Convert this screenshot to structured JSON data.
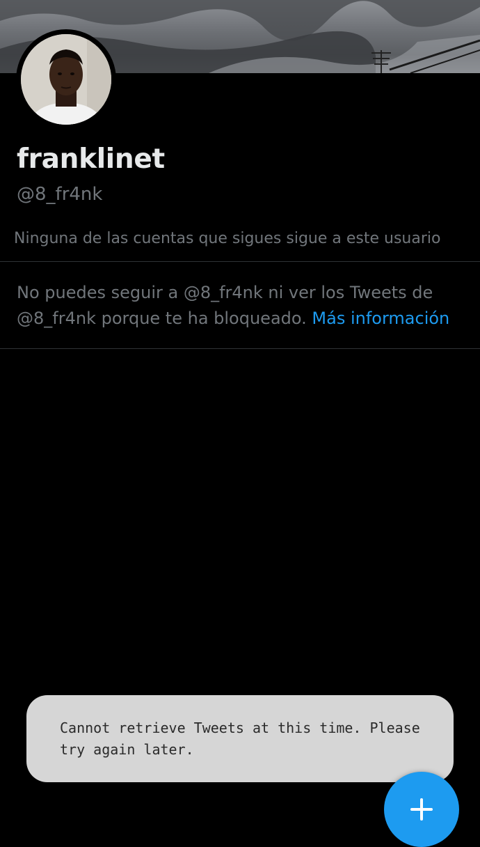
{
  "profile": {
    "display_name": "franklinet",
    "handle": "@8_fr4nk",
    "followers_you_know": "Ninguna de las cuentas que sigues sigue a este usuario"
  },
  "blocked_notice": {
    "text": "No puedes seguir a @8_fr4nk ni ver los Tweets de @8_fr4nk porque te ha bloqueado.",
    "link_label": "Más información"
  },
  "toast": {
    "message": "Cannot retrieve Tweets at this time. Please try again later."
  },
  "fab": {
    "icon": "plus-icon"
  },
  "colors": {
    "background": "#000000",
    "primary_text": "#e7e9ea",
    "secondary_text": "#71767b",
    "accent": "#1d9bf0",
    "toast_bg": "#d6d6d6"
  }
}
